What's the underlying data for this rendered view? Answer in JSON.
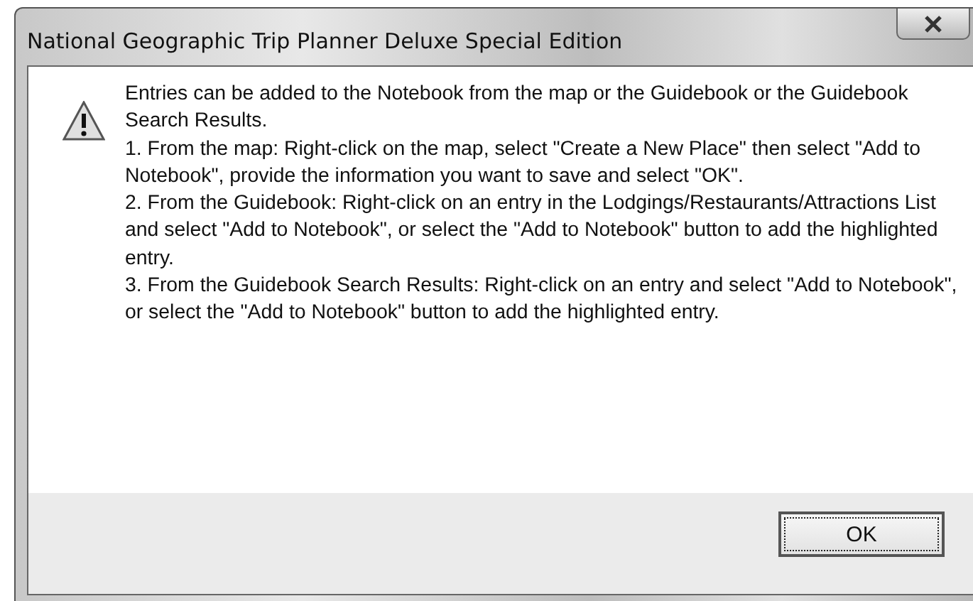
{
  "window": {
    "title": "National Geographic Trip Planner Deluxe Special Edition"
  },
  "message": {
    "paragraphs": [
      "Entries can be added to the Notebook from the map or the Guidebook or the Guidebook Search Results.",
      "1. From the map: Right-click on the map, select \"Create a New Place\" then select \"Add to Notebook\", provide the information you want to save and select \"OK\".",
      "2. From the Guidebook: Right-click on an entry in the Lodgings/Restaurants/Attractions List and select \"Add to Notebook\", or select the \"Add to Notebook\" button to add the highlighted entry.",
      "3. From the Guidebook Search Results: Right-click on an entry and select \"Add to Notebook\", or select the \"Add to Notebook\" button to add the highlighted entry."
    ]
  },
  "buttons": [
    {
      "label": "OK",
      "focused": true
    }
  ]
}
